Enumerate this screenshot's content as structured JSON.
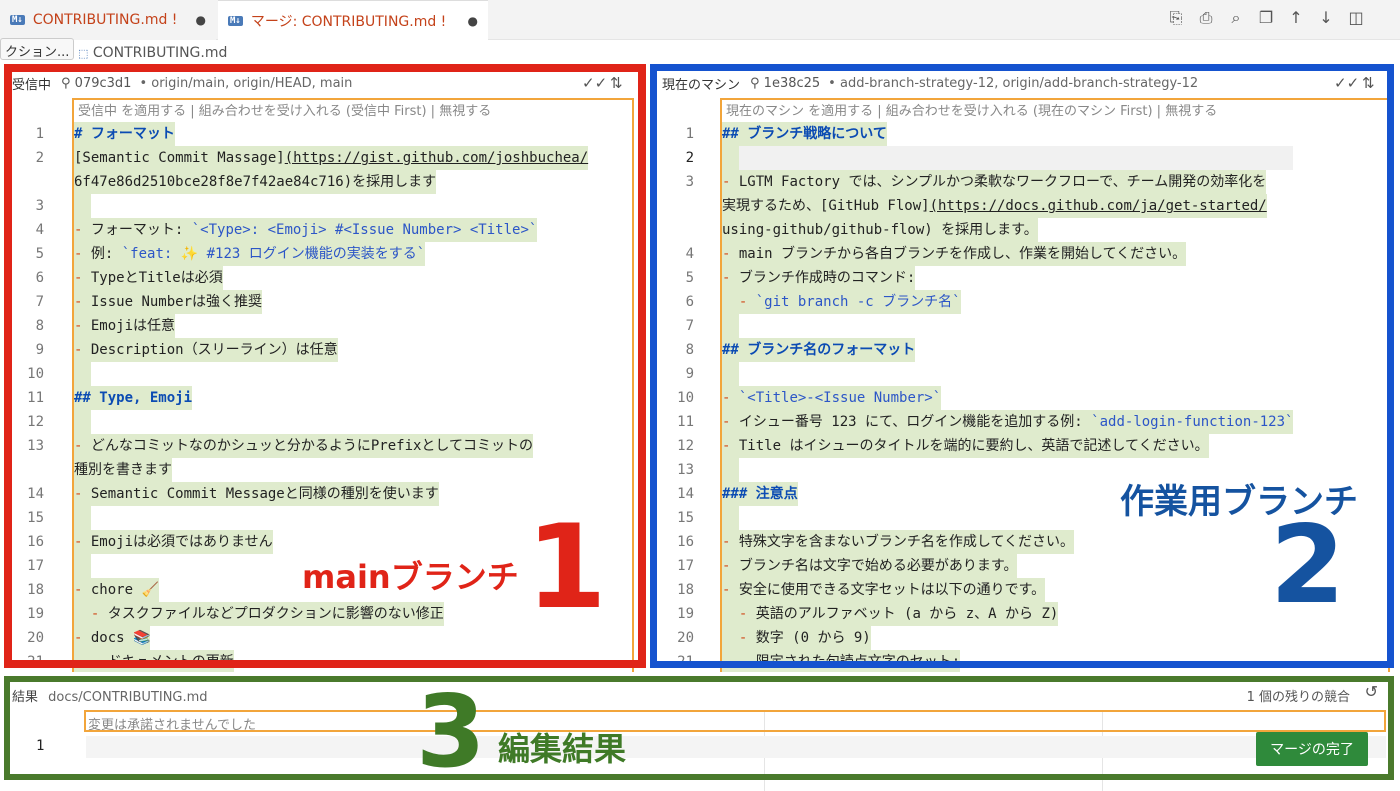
{
  "tabs": [
    {
      "badge": "M↓",
      "label": "CONTRIBUTING.md !",
      "modified": "●"
    },
    {
      "badge": "M↓",
      "label": "マージ: CONTRIBUTING.md !",
      "modified": "●"
    }
  ],
  "toolbar_icons": [
    "open-changes-icon",
    "print-icon",
    "preview-icon",
    "copy-icon",
    "arrow-up-icon",
    "arrow-down-icon",
    "split-editor-icon",
    "more-icon"
  ],
  "breadcrumb": {
    "hint": "クション...",
    "file": "CONTRIBUTING.md"
  },
  "incoming": {
    "title": "受信中",
    "hash": "⚲ 079c3d1",
    "refs": "• origin/main, origin/HEAD, main",
    "codelens": "受信中 を適用する | 組み合わせを受け入れる (受信中 First) | 無視する",
    "line_numbers": [
      "1",
      "2",
      "",
      "3",
      "4",
      "5",
      "6",
      "7",
      "8",
      "9",
      "10",
      "11",
      "12",
      "13",
      "",
      "14",
      "15",
      "16",
      "17",
      "18",
      "19",
      "20",
      "21"
    ],
    "lines": [
      "# フォーマット",
      "[Semantic Commit Massage](https://gist.github.com/joshbuchea/",
      "6f47e86d2510bce28f8e7f42ae84c716)を採用します",
      "",
      "- フォーマット: `<Type>: <Emoji> #<Issue Number> <Title>`",
      "- 例: `feat: ✨ #123 ログイン機能の実装をする`",
      "- TypeとTitleは必須",
      "- Issue Numberは強く推奨",
      "- Emojiは任意",
      "- Description（スリーライン）は任意",
      "",
      "## Type, Emoji",
      "",
      "- どんなコミットなのかシュッと分かるようにPrefixとしてコミットの",
      "種別を書きます",
      "- Semantic Commit Messageと同様の種別を使います",
      "",
      "- Emojiは必須ではありません",
      "",
      "- chore 🧹",
      "  - タスクファイルなどプロダクションに影響のない修正",
      "- docs 📚",
      "  - ドキュメントの更新"
    ]
  },
  "current": {
    "title": "現在のマシン",
    "hash": "⚲ 1e38c25",
    "refs": "• add-branch-strategy-12, origin/add-branch-strategy-12",
    "codelens": "現在のマシン を適用する | 組み合わせを受け入れる (現在のマシン First) | 無視する",
    "line_numbers": [
      "1",
      "2",
      "3",
      "",
      "",
      "4",
      "5",
      "6",
      "7",
      "8",
      "9",
      "10",
      "11",
      "12",
      "13",
      "14",
      "15",
      "16",
      "17",
      "18",
      "19",
      "20",
      "21"
    ],
    "lines": [
      "## ブランチ戦略について",
      "",
      "- LGTM Factory では、シンプルかつ柔軟なワークフローで、チーム開発の効率化を",
      "実現するため、[GitHub Flow](https://docs.github.com/ja/get-started/",
      "using-github/github-flow) を採用します。",
      "- main ブランチから各自ブランチを作成し、作業を開始してください。",
      "- ブランチ作成時のコマンド:",
      "  - `git branch -c ブランチ名`",
      "",
      "## ブランチ名のフォーマット",
      "",
      "- `<Title>-<Issue Number>`",
      "- イシュー番号 123 にて、ログイン機能を追加する例: `add-login-function-123`",
      "- Title はイシューのタイトルを端的に要約し、英語で記述してください。",
      "",
      "### 注意点",
      "",
      "- 特殊文字を含まないブランチ名を作成してください。",
      "- ブランチ名は文字で始める必要があります。",
      "- 安全に使用できる文字セットは以下の通りです。",
      "  - 英語のアルファベット (a から z、A から Z)",
      "  - 数字 (0 から 9)",
      "  - 限定された句読点文字のセット:"
    ]
  },
  "result": {
    "title": "結果",
    "path": "docs/CONTRIBUTING.md",
    "conflicts": "1 個の残りの競合",
    "codelens": "変更は承諾されませんでした",
    "line_number": "1",
    "complete_button": "マージの完了"
  },
  "annotations": {
    "left_label": "mainブランチ",
    "left_number": "1",
    "right_label": "作業用ブランチ",
    "right_number": "2",
    "bottom_number": "3",
    "bottom_label": "編集結果"
  },
  "colors": {
    "red_frame": "#e02418",
    "blue_frame": "#1553cf",
    "green_frame": "#4a7a2c",
    "conflict_highlight": "#dfebcd",
    "codelens_border": "#f2a53b",
    "merge_button": "#2f8a3b"
  }
}
